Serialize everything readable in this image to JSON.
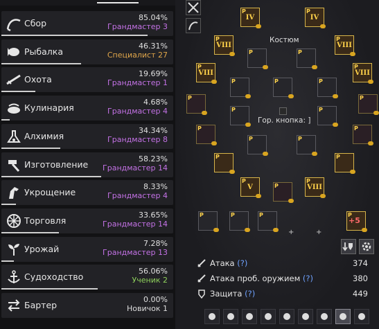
{
  "skills": [
    {
      "icon": "sickle-icon",
      "name": "Сбор",
      "percent": "85.04%",
      "rank": "Грандмастер 3",
      "rank_class": "gm",
      "progress": 0.8504
    },
    {
      "icon": "fish-icon",
      "name": "Рыбалка",
      "percent": "46.31%",
      "rank": "Специалист 27",
      "rank_class": "spec",
      "progress": 0.4631
    },
    {
      "icon": "rifle-icon",
      "name": "Охота",
      "percent": "19.69%",
      "rank": "Грандмастер 1",
      "rank_class": "gm",
      "progress": 0.1969
    },
    {
      "icon": "cooking-pot-icon",
      "name": "Кулинария",
      "percent": "4.68%",
      "rank": "Грандмастер 4",
      "rank_class": "gm",
      "progress": 0.0468
    },
    {
      "icon": "flask-icon",
      "name": "Алхимия",
      "percent": "34.34%",
      "rank": "Грандмастер 8",
      "rank_class": "gm",
      "progress": 0.3434
    },
    {
      "icon": "hammer-icon",
      "name": "Изготовление",
      "percent": "58.23%",
      "rank": "Грандмастер 14",
      "rank_class": "gm",
      "progress": 0.5823
    },
    {
      "icon": "horse-icon",
      "name": "Укрощение",
      "percent": "8.33%",
      "rank": "Грандмастер 4",
      "rank_class": "gm",
      "progress": 0.0833
    },
    {
      "icon": "wheel-icon",
      "name": "Торговля",
      "percent": "33.65%",
      "rank": "Грандмастер 14",
      "rank_class": "gm",
      "progress": 0.3365
    },
    {
      "icon": "sprout-icon",
      "name": "Урожай",
      "percent": "7.28%",
      "rank": "Грандмастер 13",
      "rank_class": "gm",
      "progress": 0.0728
    },
    {
      "icon": "anchor-icon",
      "name": "Судоходство",
      "percent": "56.06%",
      "rank": "Ученик 2",
      "rank_class": "app",
      "progress": 0.5606
    },
    {
      "icon": "barter-arrows-icon",
      "name": "Бартер",
      "percent": "0.00%",
      "rank": "Новичок 1",
      "rank_class": "nov",
      "progress": 0.0
    }
  ],
  "equipment": {
    "costume_label": "Костюм",
    "hotkey_label": "Гор. кнопка: ]",
    "enhancement_badges": [
      "IV",
      "VIII",
      "VIII",
      "VIII",
      "VIII",
      "V",
      "VIII"
    ],
    "plus_label": "+5",
    "plus_sign": "+",
    "p_badge": "P"
  },
  "stats": [
    {
      "icon": "sword-icon",
      "label": "Атака",
      "help": "(?)",
      "value": "374"
    },
    {
      "icon": "sword-icon",
      "label": "Атака проб. оружием",
      "help": "(?)",
      "value": "380"
    },
    {
      "icon": "shield-icon",
      "label": "Защита",
      "help": "(?)",
      "value": "449"
    }
  ]
}
